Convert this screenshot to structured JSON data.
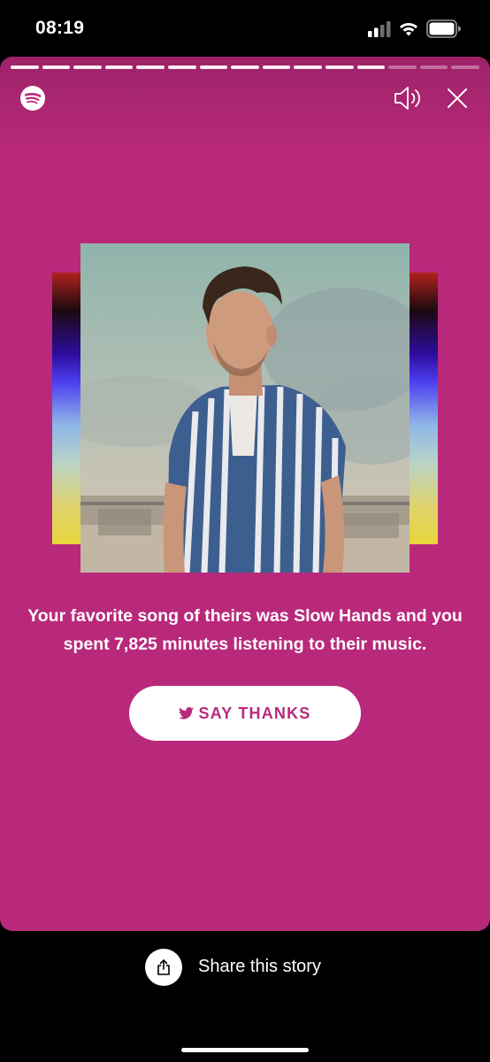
{
  "status_bar": {
    "time": "08:19",
    "icons": [
      "cellular-signal-icon",
      "wifi-icon",
      "battery-icon"
    ]
  },
  "story": {
    "progress": {
      "total_segments": 15,
      "completed_segments": 12
    },
    "header_icons": [
      "spotify-logo-icon",
      "volume-icon",
      "close-icon"
    ],
    "message_prefix": "Your favorite song of theirs was ",
    "song_title": "Slow Hands",
    "message_suffix": " and you spent 7,825 minutes listening to their music.",
    "say_thanks_label": "SAY THANKS",
    "say_thanks_icon": "twitter-bird-icon"
  },
  "share": {
    "label": "Share this story",
    "icon": "share-icon"
  },
  "colors": {
    "card_background": "#b9297b",
    "page_background": "#000000",
    "button_text": "#b9297b"
  }
}
